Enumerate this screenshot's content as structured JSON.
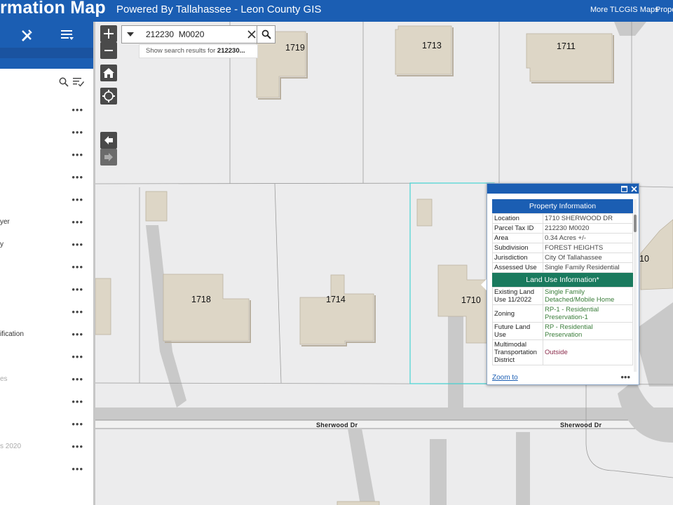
{
  "header": {
    "title": "rmation Map",
    "subtitle": "Powered By Tallahassee - Leon County GIS",
    "links": [
      "More TLCGIS Maps",
      "Prope"
    ]
  },
  "sidebar": {
    "layers": [
      {
        "label": "",
        "dim": false
      },
      {
        "label": "",
        "dim": false
      },
      {
        "label": "",
        "dim": false
      },
      {
        "label": "",
        "dim": false
      },
      {
        "label": "",
        "dim": false
      },
      {
        "label": "yer",
        "dim": false
      },
      {
        "label": "y",
        "dim": false
      },
      {
        "label": "",
        "dim": false
      },
      {
        "label": "",
        "dim": false
      },
      {
        "label": "",
        "dim": false
      },
      {
        "label": "ification",
        "dim": false
      },
      {
        "label": "",
        "dim": false
      },
      {
        "label": "es",
        "dim": true
      },
      {
        "label": "",
        "dim": false
      },
      {
        "label": "",
        "dim": false
      },
      {
        "label": "s 2020",
        "dim": true
      },
      {
        "label": "",
        "dim": false
      }
    ],
    "more_glyph": "•••"
  },
  "search": {
    "value": "212230  M0020",
    "suggestion_prefix": "Show search results for ",
    "suggestion_term": "212230..."
  },
  "map": {
    "lots": [
      "1719",
      "1713",
      "1711",
      "1718",
      "1714",
      "1710",
      "10"
    ],
    "roads": [
      "Sherwood Dr",
      "Sherwood Dr"
    ]
  },
  "popup": {
    "property_header": "Property Information",
    "property_rows": [
      {
        "key": "Location",
        "value": "1710 SHERWOOD DR"
      },
      {
        "key": "Parcel Tax ID",
        "value": "212230 M0020"
      },
      {
        "key": "Area",
        "value": "0.34 Acres +/-"
      },
      {
        "key": "Subdivision",
        "value": "FOREST HEIGHTS"
      },
      {
        "key": "Jurisdiction",
        "value": "City Of Tallahassee"
      },
      {
        "key": "Assessed Use",
        "value": "Single Family Residential"
      }
    ],
    "land_use_header": "Land Use Information*",
    "land_use_rows": [
      {
        "key": "Existing Land Use 11/2022",
        "value": "Single Family Detached/Mobile Home"
      },
      {
        "key": "Zoning",
        "value": "RP-1 - Residential Preservation-1"
      },
      {
        "key": "Future Land Use",
        "value": "RP - Residential Preservation"
      },
      {
        "key": "Multimodal Transportation District",
        "value": "Outside"
      }
    ],
    "zoom_label": "Zoom to",
    "more_glyph": "•••"
  },
  "colors": {
    "header_blue": "#1b5eb3",
    "land_use_green": "#1a7a5e",
    "building": "#ddd6c6",
    "selection": "#45d4d4"
  }
}
